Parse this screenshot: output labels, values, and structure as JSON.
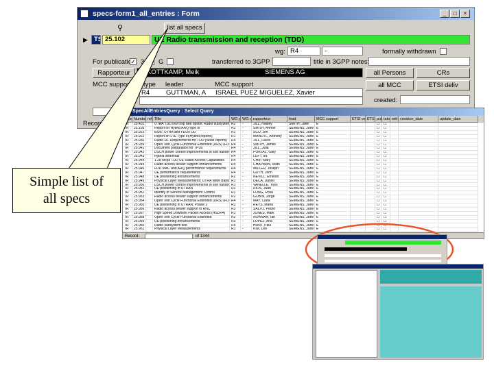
{
  "form_window": {
    "title": "specs-form1_all_entries : Form",
    "window_buttons": [
      "_",
      "□",
      "×"
    ],
    "list_all_specs_label": "list all specs",
    "binoculars_icon": "binoculars-icon",
    "record_pointer_icon": "triangle-right-icon",
    "type_value": "TS",
    "spec_number": "25.102",
    "spec_title": "UE Radio transmission and reception (TDD)",
    "wg_label": "wg:",
    "wg_value": "R4",
    "wg_value2": "-",
    "formally_withdrawn_label": "formally withdrawn",
    "for_publication_label": "For publication",
    "for_publication_checked": "✓",
    "label_3": "3",
    "label_g": "G",
    "transferred_label": "transferred to 3GPP",
    "title_3gpp_label": "title in 3GPP notes:",
    "rapporteur_button": "Rapporteur",
    "rapporteur_name": "KOTTKAMP, Meik",
    "rapporteur_company": "SIEMENS AG",
    "all_persons_button": "all Persons",
    "crs_button": "CRs",
    "mcc_support_label": "MCC support",
    "col_type": "type",
    "col_leader": "leader",
    "col_mcc_support": "MCC support",
    "row_type": "R4",
    "row_leader": "GUTTMAN, A",
    "row_mcc": "ISRAEL PUEZ MIGUELEZ, Xavier",
    "all_mcc_button": "all MCC",
    "etsi_deliverables_button": "ETSI deliv",
    "created_label": "created:",
    "records_label": "Record:"
  },
  "grid_window": {
    "title": "SpecAllEntriesQuery : Select Query",
    "columns": [
      "Type",
      "Number",
      "ref-grid",
      "Title",
      "WG prime",
      "WG other",
      "rapporteur",
      "lead",
      "MCC support",
      "ETSI vers",
      "ETSI ref",
      "publish",
      "taken-over",
      "withdrawn",
      "creation_date",
      "update_date"
    ],
    "rows": [
      [
        "TR",
        "25.401",
        "",
        "UTRA TDD low chip rate option; Radio subsystem test",
        "R2",
        "-",
        "JILL, Hadley",
        "SMITH, Jane",
        "E",
        "",
        "",
        ""
      ],
      [
        "TR",
        "25.105",
        "",
        "Report for Hybrid ARQ type III",
        "R1",
        "-",
        "SMITH, Ahmet",
        "SEIMENS, Jane",
        "E",
        "",
        "",
        ""
      ],
      [
        "TR",
        "25.923",
        "",
        "BS/E; UTRA and FDD/TDD",
        "R1",
        "-",
        "SCO, Jim",
        "SEIMENS, Jane",
        "E",
        "",
        "",
        ""
      ],
      [
        "TR",
        "25.922",
        "",
        "Report on LTE Type III(Hybrid reports)",
        "R1",
        "-",
        "MANOTL, Anthony",
        "SEIMENS, Jane",
        "E",
        "",
        "",
        ""
      ],
      [
        "TR",
        "25.936",
        "",
        "Radio RF Requirements for TDD (Node reports)",
        "R4",
        "-",
        "JILL, Laura",
        "SEIMENS, Jane",
        "E",
        "",
        "",
        ""
      ],
      [
        "TR",
        "25.939",
        "",
        "Open Test Cycle Functional Extended (URS) (FDD)",
        "R4",
        "-",
        "SMITH, James",
        "SEIMENS, Jane",
        "E",
        "",
        "",
        ""
      ],
      [
        "TR",
        "25.941",
        "",
        "Document preparation for TPUs",
        "R4",
        "-",
        "JILL, Julia",
        "SEIMENS, Jane",
        "E",
        "",
        "",
        ""
      ],
      [
        "TR",
        "25.942",
        "",
        "DSCH power control improvements in soft handover",
        "R4",
        "-",
        "PORTAL, Gary",
        "SEIMENS, Jane",
        "E",
        "",
        "",
        ""
      ],
      [
        "TR",
        "25.943",
        "",
        "Hybrid antennas",
        "R4",
        "-",
        "LUFT, Ira",
        "SEIMENS, Jane",
        "E",
        "",
        "",
        ""
      ],
      [
        "TR",
        "25.944",
        "",
        "1.28 Mcps TDD UE Radio Access Capabilities",
        "R4",
        "-",
        "CHIP, Mary",
        "SEIMENS, Jane",
        "E",
        "",
        "",
        ""
      ],
      [
        "TR",
        "25.945",
        "",
        "Radio access bearer support enhancements",
        "R4",
        "-",
        "CHAPMAN, Mark",
        "SEIMENS, Jane",
        "E",
        "",
        "",
        ""
      ],
      [
        "TR",
        "25.946",
        "",
        "FDD MAC and ARQ performance requirements",
        "R4",
        "-",
        "MILLER, Joseph",
        "SEIMENS, Jane",
        "E",
        "",
        "",
        ""
      ],
      [
        "TR",
        "25.947",
        "",
        "UE performance requirements",
        "R4",
        "-",
        "GUTH, John",
        "SEIMENS, Jane",
        "E",
        "",
        "",
        ""
      ],
      [
        "TR",
        "25.948",
        "",
        "UE positioning enhancements",
        "R2",
        "-",
        "NEVILL, Ernesto",
        "SEIMENS, Jane",
        "E",
        "",
        "",
        ""
      ],
      [
        "TR",
        "25.949",
        "",
        "Physical Layer Measurements; UTRA Wide Bandwidth",
        "R1",
        "-",
        "DECA, Daniel",
        "SEIMENS, Jane",
        "E",
        "",
        "",
        ""
      ],
      [
        "TR",
        "25.950",
        "",
        "DSCH power control improvements in soft handover",
        "R1",
        "-",
        "VANELLE, Yves",
        "SEIMENS, Jane",
        "E",
        "",
        "",
        ""
      ],
      [
        "TR",
        "25.951",
        "",
        "UE positioning in UTRAN",
        "R1",
        "-",
        "RIOS, Juan",
        "SEIMENS, Jane",
        "E",
        "",
        "",
        ""
      ],
      [
        "TR",
        "25.952",
        "",
        "Identity of Service Management Control",
        "R1",
        "-",
        "FONG, Rosa",
        "SEIMENS, Jane",
        "E",
        "",
        "",
        ""
      ],
      [
        "TR",
        "25.953",
        "",
        "Radio access bearer support enhancements",
        "R2",
        "-",
        "GOBIN, Jorge",
        "SEIMENS, Jane",
        "E",
        "",
        "",
        ""
      ],
      [
        "TR",
        "25.954",
        "",
        "Open Test Cycle Functional Extended (URS) (FDD)",
        "R4",
        "-",
        "MAY, Clara",
        "SEIMENS, Jane",
        "E",
        "",
        "",
        ""
      ],
      [
        "TR",
        "25.955",
        "",
        "UE positioning in UTRAN; Phase 2",
        "R3",
        "-",
        "REYS, Maria",
        "SEIMENS, Jane",
        "E",
        "",
        "",
        ""
      ],
      [
        "TR",
        "25.956",
        "",
        "Radio access bearer support in RNC",
        "R3",
        "-",
        "SALTO, Pedro",
        "SEIMENS, Jane",
        "E",
        "",
        "",
        ""
      ],
      [
        "TR",
        "25.957",
        "",
        "High Speed Downlink Packet Access (HSDPA)",
        "R1",
        "-",
        "JONES, Mark",
        "SEIMENS, Jane",
        "E",
        "",
        "",
        ""
      ],
      [
        "TR",
        "25.958",
        "",
        "Open Test Cycle Functional Extended",
        "R2",
        "-",
        "NORMAN, Ian",
        "SEIMENS, Jane",
        "E",
        "",
        "",
        ""
      ],
      [
        "TR",
        "25.959",
        "",
        "UE positioning enhancements",
        "R3",
        "-",
        "LOPEZ, Ana",
        "SEIMENS, Jane",
        "E",
        "",
        "",
        ""
      ],
      [
        "TR",
        "25.960",
        "",
        "Radio subsystem test",
        "R4",
        "-",
        "HUNT, Paul",
        "SEIMENS, Jane",
        "E",
        "",
        "",
        ""
      ],
      [
        "TR",
        "25.961",
        "",
        "Physical Layer Measurements",
        "R1",
        "-",
        "KIM, Lee",
        "SEIMENS, Jane",
        "E",
        "",
        "",
        ""
      ]
    ],
    "record_label": "Record:",
    "record_total": "of 1344"
  },
  "callout": {
    "line1": "Simple list of",
    "line2": "all specs"
  },
  "colors": {
    "title_green": "#33e633",
    "callout_bg": "#ffffe6",
    "oval": "#e8542a",
    "window_face": "#d4d0c8",
    "titlebar": "#0a246a"
  }
}
